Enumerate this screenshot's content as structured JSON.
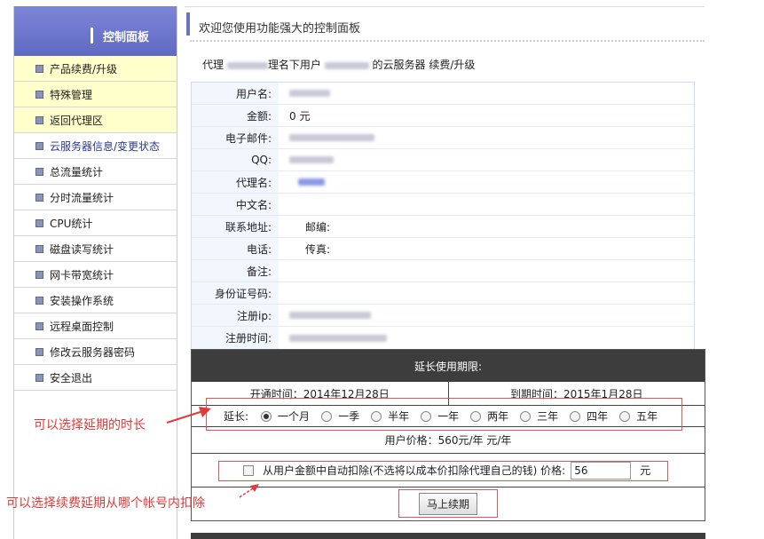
{
  "sidebar": {
    "title": "控制面板",
    "items": [
      {
        "label": "产品续费/升级"
      },
      {
        "label": "特殊管理"
      },
      {
        "label": "返回代理区"
      },
      {
        "label": "云服务器信息/变更状态"
      },
      {
        "label": "总流量统计"
      },
      {
        "label": "分时流量统计"
      },
      {
        "label": "CPU统计"
      },
      {
        "label": "磁盘读写统计"
      },
      {
        "label": "网卡带宽统计"
      },
      {
        "label": "安装操作系统"
      },
      {
        "label": "远程桌面控制"
      },
      {
        "label": "修改云服务器密码"
      },
      {
        "label": "安全退出"
      }
    ]
  },
  "header": {
    "title": "欢迎您使用功能强大的控制面板"
  },
  "subtitle": {
    "prefix": "代理",
    "mid": "理名下用户",
    "suffix": "的云服务器 续费/升级"
  },
  "info": {
    "username_label": "用户名:",
    "balance_label": "金额:",
    "balance_value": "0 元",
    "email_label": "电子邮件:",
    "qq_label": "QQ:",
    "agent_label": "代理名:",
    "cnname_label": "中文名:",
    "address_label": "联系地址:",
    "zip_label": "邮编:",
    "phone_label": "电话:",
    "fax_label": "传真:",
    "note_label": "备注:",
    "id_label": "身份证号码:",
    "regip_label": "注册ip:",
    "regtime_label": "注册时间:"
  },
  "renew": {
    "head": "延长使用期限:",
    "open_time": "开通时间：2014年12月28日",
    "expire_time": "到期时间：2015年1月28日",
    "extend_label": "延长:",
    "options": [
      "一个月",
      "一季",
      "半年",
      "一年",
      "两年",
      "三年",
      "四年",
      "五年"
    ],
    "price_text": "用户价格：560元/年 元/年",
    "deduct_text": "从用户金额中自动扣除(不选将以成本价扣除代理自己的钱) 价格:",
    "price_value": "56",
    "yuan": "元",
    "submit": "马上续期"
  },
  "annotations": {
    "a1": "可以选择延期的时长",
    "a2": "可以选择续费延期从哪个帐号内扣除"
  },
  "colors": {
    "accent": "#6b73c7",
    "annotation": "#e03a3a"
  }
}
